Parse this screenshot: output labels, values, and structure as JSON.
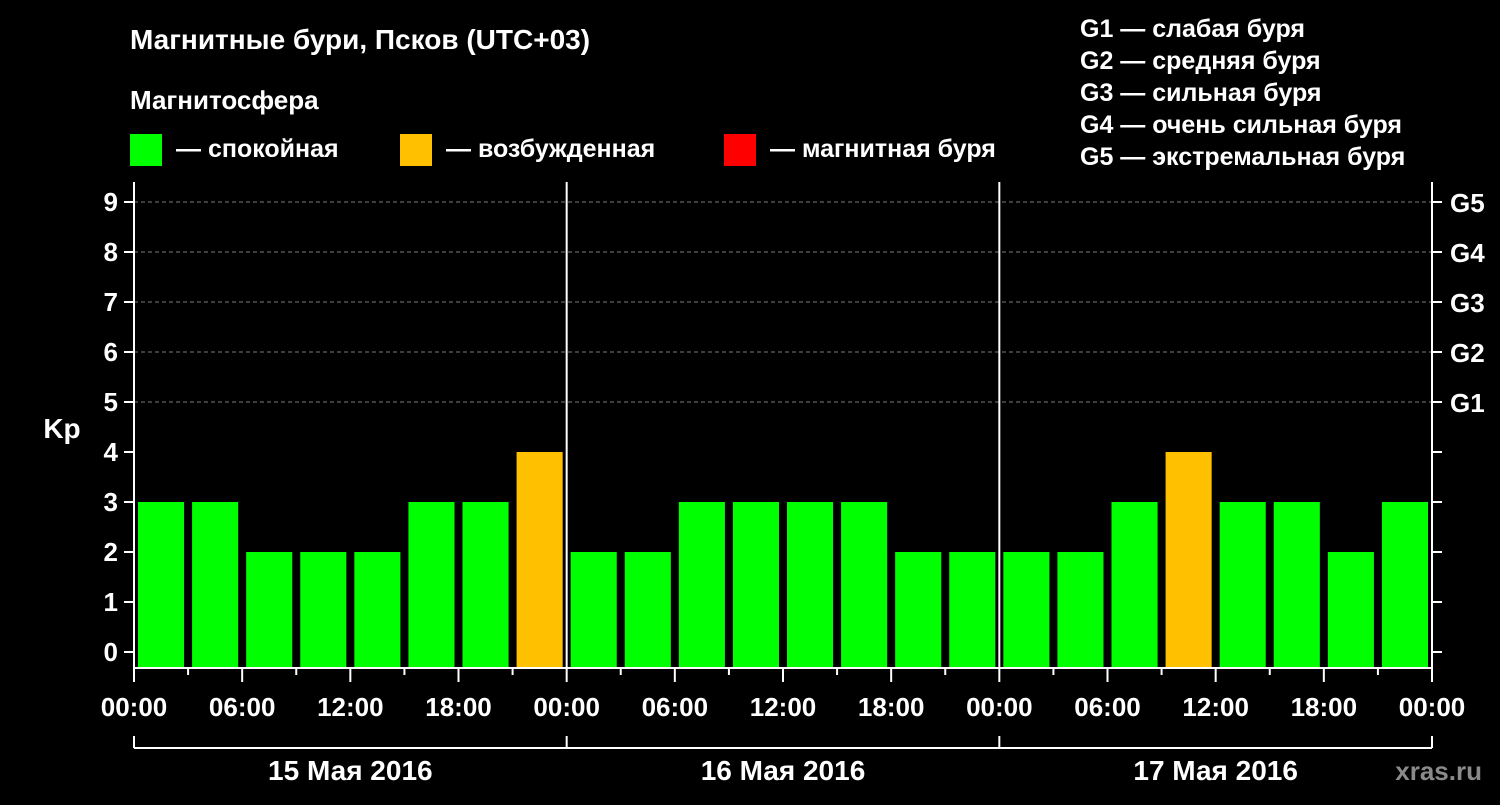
{
  "header": {
    "title": "Магнитные бури, Псков (UTC+03)",
    "subtitle": "Магнитосфера",
    "site": "xras.ru"
  },
  "legend": {
    "status": [
      {
        "label": "— спокойная",
        "color": "#00ff00"
      },
      {
        "label": "— возбужденная",
        "color": "#ffc000"
      },
      {
        "label": "— магнитная буря",
        "color": "#ff0000"
      }
    ],
    "storm_levels": [
      "G1 — слабая буря",
      "G2 — средняя буря",
      "G3 — сильная буря",
      "G4 — очень сильная буря",
      "G5 — экстремальная буря"
    ]
  },
  "chart_data": {
    "type": "bar",
    "ylabel": "Kp",
    "ylim": [
      0,
      9
    ],
    "grid": true,
    "y_ticks": [
      "0",
      "1",
      "2",
      "3",
      "4",
      "5",
      "6",
      "7",
      "8",
      "9"
    ],
    "g_ticks": [
      {
        "kp": 5,
        "label": "G1"
      },
      {
        "kp": 6,
        "label": "G2"
      },
      {
        "kp": 7,
        "label": "G3"
      },
      {
        "kp": 8,
        "label": "G4"
      },
      {
        "kp": 9,
        "label": "G5"
      }
    ],
    "x_ticks": [
      "00:00",
      "06:00",
      "12:00",
      "18:00",
      "00:00",
      "06:00",
      "12:00",
      "18:00",
      "00:00",
      "06:00",
      "12:00",
      "18:00",
      "00:00"
    ],
    "days": [
      "15 Мая 2016",
      "16 Мая 2016",
      "17 Мая 2016"
    ],
    "values": [
      3,
      3,
      2,
      2,
      2,
      3,
      3,
      4,
      2,
      2,
      3,
      3,
      3,
      3,
      2,
      2,
      2,
      2,
      3,
      4,
      3,
      3,
      2,
      3
    ],
    "colors": {
      "quiet": "#00ff00",
      "active": "#ffc000",
      "storm": "#ff0000"
    }
  }
}
